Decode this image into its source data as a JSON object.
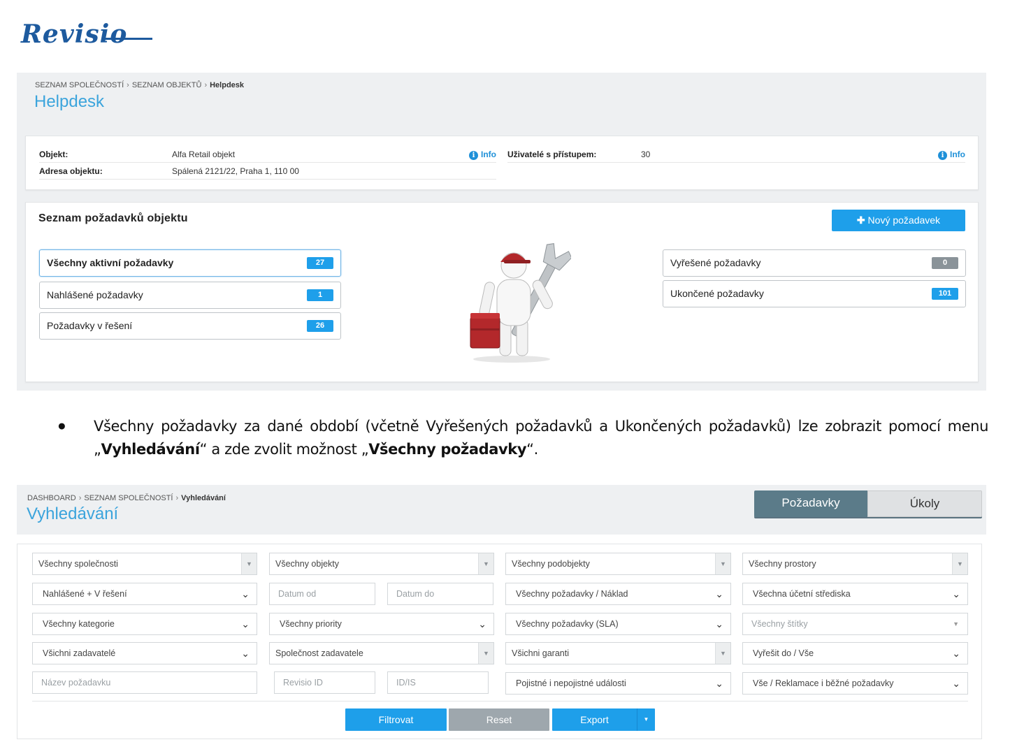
{
  "logo": {
    "text": "Revisio"
  },
  "screen1": {
    "breadcrumb": {
      "item1": "SEZNAM SPOLEČNOSTÍ",
      "item2": "SEZNAM OBJEKTŮ",
      "current": "Helpdesk"
    },
    "title": "Helpdesk",
    "info": {
      "objekt_label": "Objekt:",
      "objekt_value": "Alfa Retail objekt",
      "adresa_label": "Adresa objektu:",
      "adresa_value": "Spálená 2121/22, Praha 1, 110 00",
      "uzivatele_label": "Uživatelé s přístupem:",
      "uzivatele_value": "30",
      "info_link": "Info"
    },
    "list": {
      "title": "Seznam požadavků objektu",
      "new_button": "Nový požadavek",
      "items_left": [
        {
          "label": "Všechny aktivní požadavky",
          "count": "27"
        },
        {
          "label": "Nahlášené požadavky",
          "count": "1"
        },
        {
          "label": "Požadavky v řešení",
          "count": "26"
        }
      ],
      "items_right": [
        {
          "label": "Vyřešené požadavky",
          "count": "0"
        },
        {
          "label": "Ukončené požadavky",
          "count": "101"
        }
      ]
    },
    "colors": {
      "accent": "#1e9fea",
      "title": "#3ba4dc"
    }
  },
  "bullet": {
    "part1": "Všechny požadavky za dané období (včetně Vyřešených požadavků a Ukončených požadavků) lze zobrazit pomocí menu „",
    "bold1": "Vyhledávání",
    "part2": "“ a zde zvolit možnost „",
    "bold2": "Všechny požadavky",
    "part3": "“."
  },
  "screen2": {
    "breadcrumb": {
      "item1": "DASHBOARD",
      "item2": "SEZNAM SPOLEČNOSTÍ",
      "current": "Vyhledávání"
    },
    "title": "Vyhledávání",
    "toggle": {
      "on": "Požadavky",
      "off": "Úkoly"
    },
    "filters": {
      "companies": "Všechny společnosti",
      "objects": "Všechny objekty",
      "subobjects": "Všechny podobjekty",
      "spaces": "Všechny prostory",
      "status": "Nahlášené + V řešení",
      "date_from": "Datum od",
      "date_to": "Datum do",
      "cost": "Všechny požadavky / Náklad",
      "centers": "Všechna účetní střediska",
      "categories": "Všechny kategorie",
      "priorities": "Všechny priority",
      "sla": "Všechny požadavky (SLA)",
      "tags": "Všechny štítky",
      "requesters": "Všichni zadavatelé",
      "requester_company": "Společnost zadavatele",
      "guarantors": "Všichni garanti",
      "resolve_by": "Vyřešit do / Vše",
      "name": "Název požadavku",
      "revisio_id": "Revisio ID",
      "id_is": "ID/IS",
      "insurance": "Pojistné i nepojistné události",
      "claims": "Vše / Reklamace i běžné požadavky"
    },
    "buttons": {
      "filter": "Filtrovat",
      "reset": "Reset",
      "export": "Export"
    }
  }
}
